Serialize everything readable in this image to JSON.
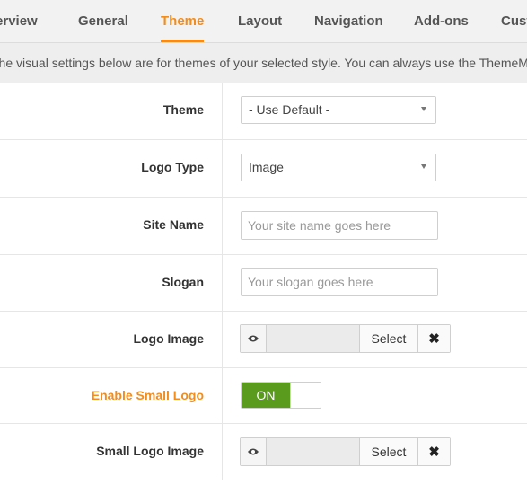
{
  "tabs": {
    "overview": "Overview",
    "general": "General",
    "theme": "Theme",
    "layout": "Layout",
    "navigation": "Navigation",
    "addons": "Add-ons",
    "custom": "Custom"
  },
  "info_text": "The visual settings below are for themes of your selected style. You can always use the ThemeMagic tool to customize them.",
  "fields": {
    "theme": {
      "label": "Theme",
      "value": "- Use Default -"
    },
    "logo_type": {
      "label": "Logo Type",
      "value": "Image"
    },
    "site_name": {
      "label": "Site Name",
      "placeholder": "Your site name goes here"
    },
    "slogan": {
      "label": "Slogan",
      "placeholder": "Your slogan goes here"
    },
    "logo_image": {
      "label": "Logo Image",
      "select_label": "Select",
      "clear_label": "✖"
    },
    "enable_small_logo": {
      "label": "Enable Small Logo",
      "state": "ON"
    },
    "small_logo_image": {
      "label": "Small Logo Image",
      "select_label": "Select",
      "clear_label": "✖"
    }
  },
  "colors": {
    "accent": "#f28c1c",
    "toggle_on": "#5a9a1c"
  },
  "icons": {
    "preview": "eye-icon",
    "clear": "close-icon",
    "dropdown": "caret-down-icon"
  }
}
